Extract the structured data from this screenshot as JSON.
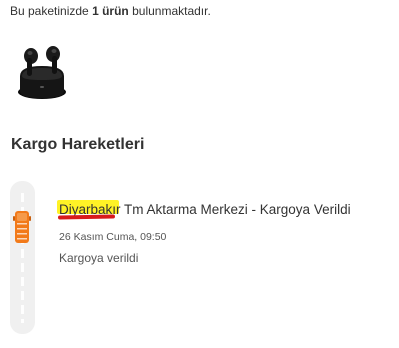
{
  "package_info": {
    "prefix": "Bu paketinizde",
    "count": "1 ürün",
    "suffix": "bulunmaktadır."
  },
  "product": {
    "image_icon": "earbuds-case-icon"
  },
  "section": {
    "title": "Kargo Hareketleri"
  },
  "tracking": {
    "icon": "truck-icon",
    "accent_color": "#f27a1a",
    "events": [
      {
        "title": "Diyarbakır Tm Aktarma Merkezi - Kargoya Verildi",
        "date": "26 Kasım Cuma, 09:50",
        "status": "Kargoya verildi"
      }
    ]
  }
}
